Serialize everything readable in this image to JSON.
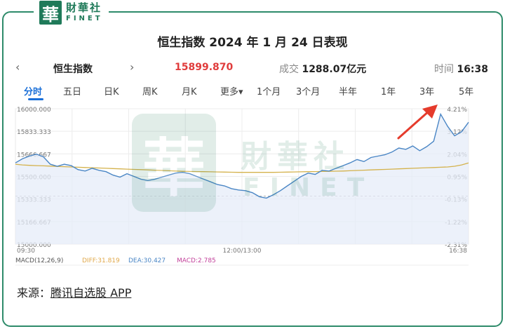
{
  "logo": {
    "mark": "華",
    "cn": "財華社",
    "en": "FINET"
  },
  "title": "恒生指数 2024 年 1 月 24 日表现",
  "infobar": {
    "prev_arrow": "‹",
    "index_name": "恒生指数",
    "next_arrow": "›",
    "price": "15899.870",
    "volume_label": "成交",
    "volume_value": "1288.07亿元",
    "time_label": "时间",
    "time_value": "16:38"
  },
  "tabs": [
    "分时",
    "五日",
    "日K",
    "周K",
    "月K",
    "更多▾",
    "1个月",
    "3个月",
    "半年",
    "1年",
    "3年",
    "5年"
  ],
  "active_tab": 0,
  "watermark": {
    "mark": "華",
    "cn": "財華社",
    "en": "FINET"
  },
  "source": {
    "label": "来源：",
    "link": "腾讯自选股 APP"
  },
  "colors": {
    "price_line": "#4a86c5",
    "avg_line": "#d4b24c",
    "area_fill": "#e6ecf8",
    "price_up": "#e03c3c",
    "macd_diff": "#e0a84a",
    "macd_dea": "#4a86c5",
    "macd_val": "#c2409a",
    "arrow": "#e53b2c"
  },
  "chart_data": {
    "type": "line",
    "title": "",
    "xlabel": "",
    "ylabel": "",
    "ylim": [
      15000,
      16000
    ],
    "y_ticks_left": [
      "16000.000",
      "15833.333",
      "15666.667",
      "15500.000",
      "15333.333",
      "15166.667",
      "15000.000"
    ],
    "y_ticks_right": [
      "4.21%",
      "3.12%",
      "2.04%",
      "0.95%",
      "-0.13%",
      "-1.22%",
      "-2.31%"
    ],
    "x_ticks": [
      "09:30",
      "12:00/13:00",
      "16:38"
    ],
    "reference_value": 15353.98,
    "series": [
      {
        "values": [
          15600,
          15630,
          15650,
          15665,
          15645,
          15590,
          15575,
          15590,
          15580,
          15550,
          15540,
          15560,
          15545,
          15535,
          15510,
          15495,
          15520,
          15500,
          15480,
          15470,
          15480,
          15495,
          15510,
          15525,
          15530,
          15520,
          15500,
          15480,
          15460,
          15440,
          15430,
          15410,
          15400,
          15395,
          15380,
          15350,
          15340,
          15365,
          15395,
          15430,
          15465,
          15500,
          15525,
          15515,
          15545,
          15540,
          15560,
          15580,
          15600,
          15625,
          15610,
          15640,
          15650,
          15660,
          15680,
          15710,
          15700,
          15725,
          15690,
          15720,
          15760,
          15960,
          15870,
          15800,
          15830,
          15900
        ]
      },
      {
        "values": [
          15590,
          15585,
          15582,
          15580,
          15578,
          15576,
          15574,
          15572,
          15570,
          15568,
          15566,
          15564,
          15562,
          15560,
          15558,
          15556,
          15554,
          15552,
          15550,
          15548,
          15546,
          15544,
          15542,
          15540,
          15538,
          15537,
          15536,
          15535,
          15534,
          15533,
          15532,
          15531,
          15530,
          15530,
          15530,
          15530,
          15530,
          15530,
          15531,
          15532,
          15533,
          15534,
          15535,
          15536,
          15537,
          15538,
          15539,
          15540,
          15542,
          15544,
          15546,
          15548,
          15550,
          15552,
          15554,
          15556,
          15558,
          15560,
          15562,
          15564,
          15566,
          15568,
          15570,
          15575,
          15585,
          15600
        ]
      }
    ],
    "macd": {
      "label": "MACD(12,26,9)",
      "diff": "DIFF:31.819",
      "dea": "DEA:30.427",
      "macd": "MACD:2.785"
    }
  }
}
